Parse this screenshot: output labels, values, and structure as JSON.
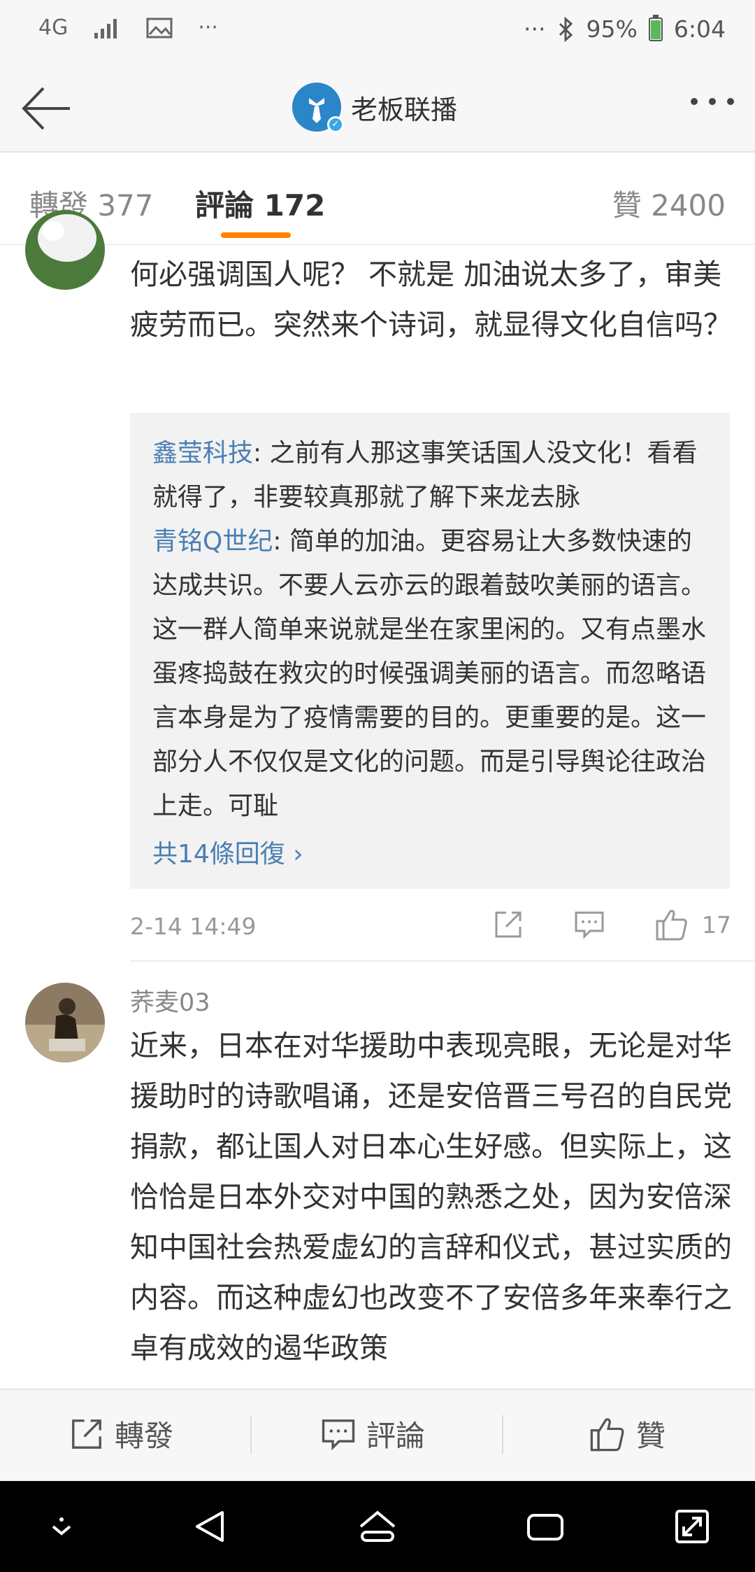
{
  "status_bar": {
    "network": "4G",
    "more": "···",
    "battery": "95%",
    "time": "6:04"
  },
  "header": {
    "back_icon": "arrow-left-icon",
    "title": "老板联播",
    "more_icon": "more-horizontal-icon"
  },
  "tabs": [
    {
      "label": "轉發 377"
    },
    {
      "label": "評論 172"
    },
    {
      "label": "贊 2400"
    }
  ],
  "comment1": {
    "text": "何必强调国人呢？ 不就是 加油说太多了，审美疲劳而已。突然来个诗词，就显得文化自信吗？",
    "replies": [
      {
        "user": "鑫莹科技",
        "text": ": 之前有人那这事笑话国人没文化！看看就得了，非要较真那就了解下来龙去脉"
      },
      {
        "user": "青铭Q世纪",
        "text": ": 简单的加油。更容易让大多数快速的达成共识。不要人云亦云的跟着鼓吹美丽的语言。这一群人简单来说就是坐在家里闲的。又有点墨水蛋疼捣鼓在救灾的时候强调美丽的语言。而忽略语言本身是为了疫情需要的目的。更重要的是。这一部分人不仅仅是文化的问题。而是引导舆论往政治上走。可耻"
      }
    ],
    "more_replies": "共14條回復 ›",
    "time": "2-14 14:49",
    "likes": "17"
  },
  "comment2": {
    "user": "荞麦03",
    "text": "近来，日本在对华援助中表现亮眼，无论是对华援助时的诗歌唱诵，还是安倍晋三号召的自民党捐款，都让国人对日本心生好感。但实际上，这恰恰是日本外交对中国的熟悉之处，因为安倍深知中国社会热爱虚幻的言辞和仪式，甚过实质的内容。而这种虚幻也改变不了安倍多年来奉行之卓有成效的遏华政策"
  },
  "action_bar": {
    "repost": "轉發",
    "comment": "評論",
    "like": "贊"
  },
  "colors": {
    "accent": "#ff8200",
    "link": "#4a7fb3"
  }
}
